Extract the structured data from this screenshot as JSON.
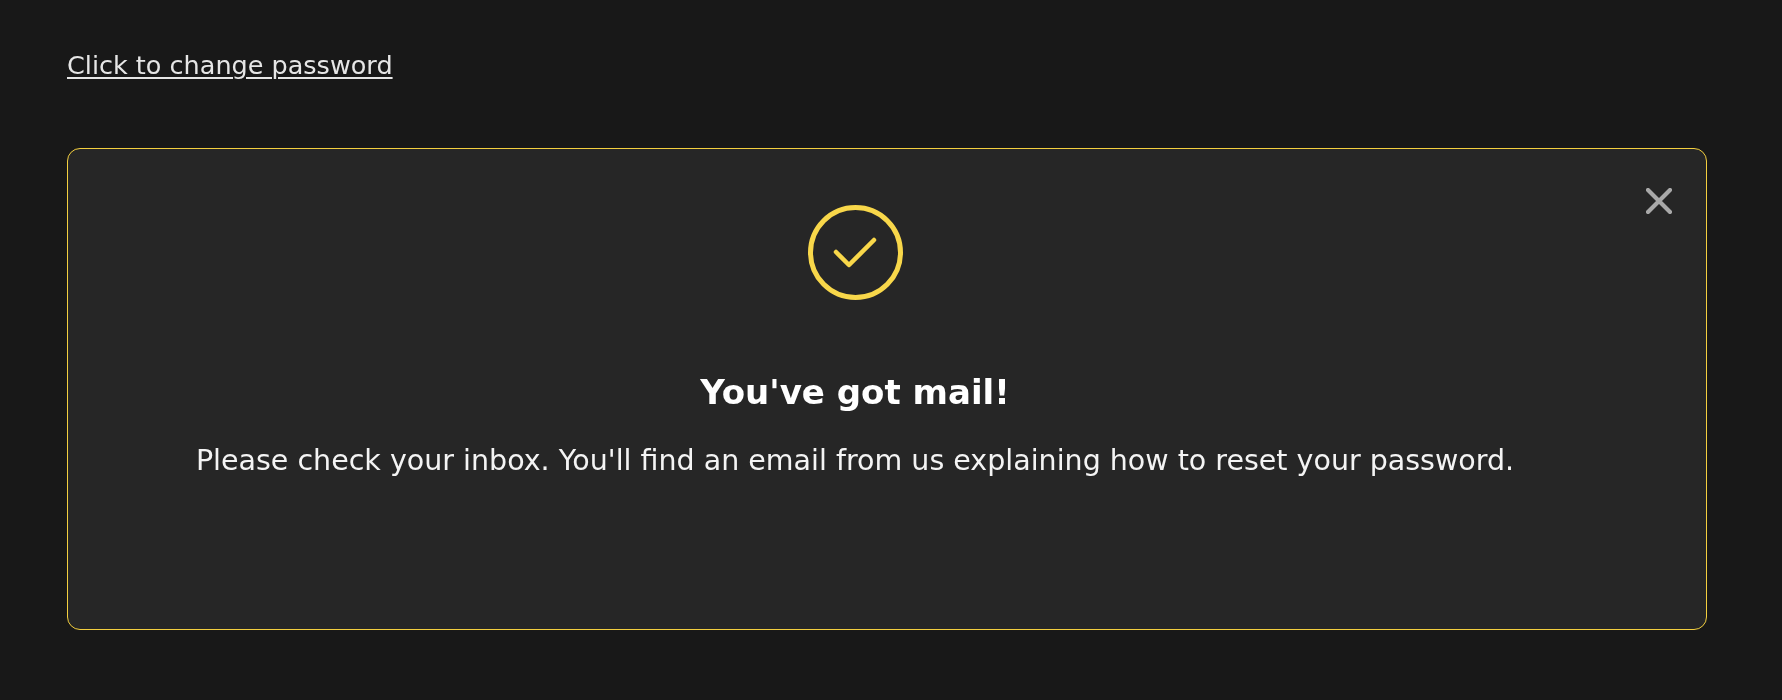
{
  "change_password_link": "Click to change password",
  "notice": {
    "title": "You've got mail!",
    "message": "Please check your inbox. You'll find an email from us explaining how to reset your password."
  }
}
